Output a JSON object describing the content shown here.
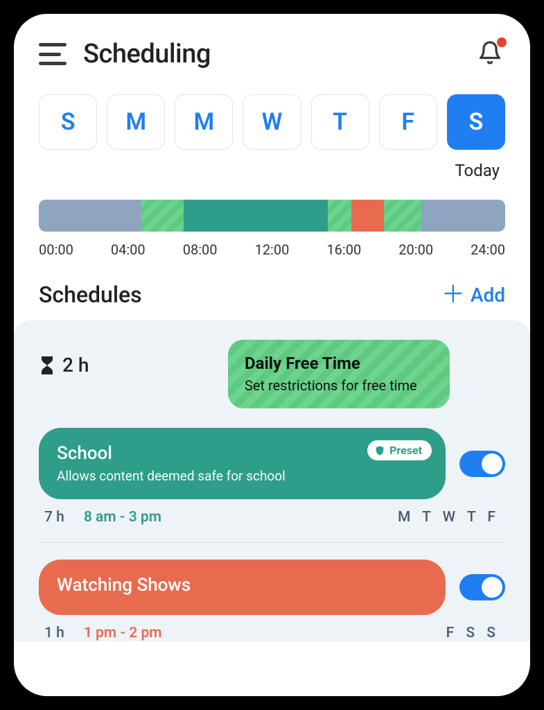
{
  "header": {
    "title": "Scheduling"
  },
  "days": {
    "items": [
      "S",
      "M",
      "M",
      "W",
      "T",
      "F",
      "S"
    ],
    "active_index": 6,
    "today_label": "Today"
  },
  "timeline": {
    "ticks": [
      "00:00",
      "04:00",
      "08:00",
      "12:00",
      "16:00",
      "20:00",
      "24:00"
    ],
    "segments": [
      {
        "kind": "blue",
        "width_pct": 22
      },
      {
        "kind": "stripe",
        "width_pct": 9
      },
      {
        "kind": "teal",
        "width_pct": 31
      },
      {
        "kind": "stripe",
        "width_pct": 5
      },
      {
        "kind": "orange",
        "width_pct": 7
      },
      {
        "kind": "stripe",
        "width_pct": 8
      },
      {
        "kind": "blue",
        "width_pct": 18
      }
    ]
  },
  "schedules": {
    "section_title": "Schedules",
    "add_label": "Add",
    "free_time": {
      "duration": "2 h",
      "title": "Daily Free Time",
      "subtitle": "Set restrictions for free time"
    },
    "items": [
      {
        "title": "School",
        "subtitle": "Allows content deemed safe for school",
        "color": "teal",
        "preset_label": "Preset",
        "has_preset": true,
        "enabled": true,
        "duration": "7 h",
        "time_range": "8 am - 3 pm",
        "days": "M T W T F"
      },
      {
        "title": "Watching Shows",
        "subtitle": "",
        "color": "orange",
        "preset_label": "",
        "has_preset": false,
        "enabled": true,
        "duration": "1 h",
        "time_range": "1 pm - 2 pm",
        "days": "F S S"
      }
    ]
  }
}
